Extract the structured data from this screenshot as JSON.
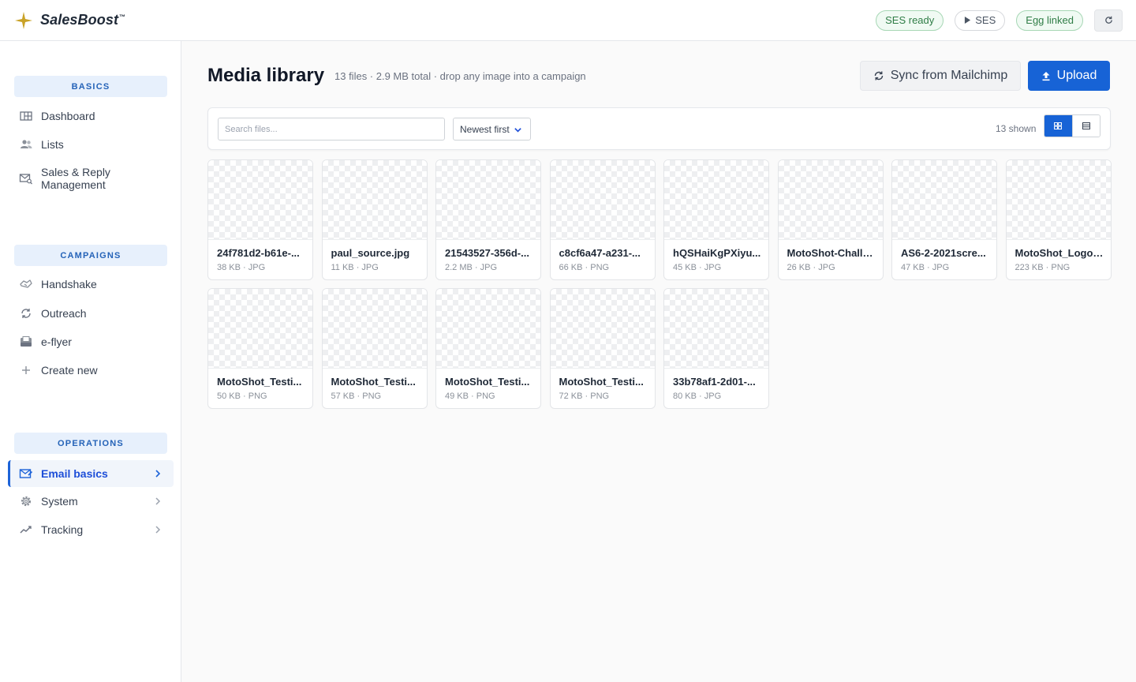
{
  "brand": {
    "name": "SalesBoost",
    "tm": "™"
  },
  "topbar": {
    "ses_ready": "SES ready",
    "ses": "SES",
    "egg_linked": "Egg linked"
  },
  "sidebar": {
    "sections": {
      "basics": "BASICS",
      "campaigns": "CAMPAIGNS",
      "operations": "OPERATIONS"
    },
    "items": {
      "dashboard": "Dashboard",
      "lists": "Lists",
      "sales_reply": "Sales & Reply Management",
      "handshake": "Handshake",
      "outreach": "Outreach",
      "eflyer": "e-flyer",
      "create_new": "Create new",
      "email_basics": "Email basics",
      "system": "System",
      "tracking": "Tracking"
    }
  },
  "page": {
    "title": "Media library",
    "subtitle": "13 files · 2.9 MB total · drop any image into a campaign",
    "sync_label": "Sync from Mailchimp",
    "upload_label": "Upload"
  },
  "toolbar": {
    "search_placeholder": "Search files...",
    "sort_label": "Newest first",
    "shown": "13 shown"
  },
  "files": [
    {
      "name": "24f781d2-b61e-...",
      "meta": "38 KB · JPG"
    },
    {
      "name": "paul_source.jpg",
      "meta": "11 KB · JPG"
    },
    {
      "name": "21543527-356d-...",
      "meta": "2.2 MB · JPG"
    },
    {
      "name": "c8cf6a47-a231-...",
      "meta": "66 KB · PNG"
    },
    {
      "name": "hQSHaiKgPXiyu...",
      "meta": "45 KB · JPG"
    },
    {
      "name": "MotoShot-Challe...",
      "meta": "26 KB · JPG"
    },
    {
      "name": "AS6-2-2021scre...",
      "meta": "47 KB · JPG"
    },
    {
      "name": "MotoShot_Logo_...",
      "meta": "223 KB · PNG"
    },
    {
      "name": "MotoShot_Testi...",
      "meta": "50 KB · PNG"
    },
    {
      "name": "MotoShot_Testi...",
      "meta": "57 KB · PNG"
    },
    {
      "name": "MotoShot_Testi...",
      "meta": "49 KB · PNG"
    },
    {
      "name": "MotoShot_Testi...",
      "meta": "72 KB · PNG"
    },
    {
      "name": "33b78af1-2d01-...",
      "meta": "80 KB · JPG"
    }
  ],
  "colors": {
    "accent": "#1763d6",
    "success": "#2f7d46",
    "brand_star": "#c9a227"
  }
}
